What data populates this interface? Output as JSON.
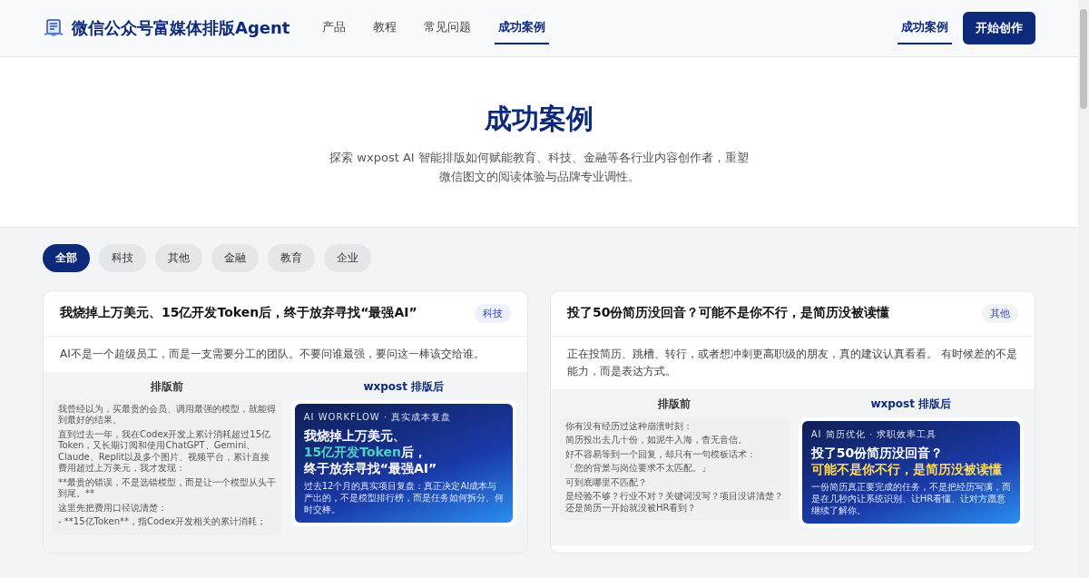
{
  "brand": {
    "name": "微信公众号富媒体排版Agent"
  },
  "nav": [
    {
      "label": "产品",
      "selected": false
    },
    {
      "label": "教程",
      "selected": false
    },
    {
      "label": "常见问题",
      "selected": false
    },
    {
      "label": "成功案例",
      "selected": true
    }
  ],
  "header_actions": {
    "link": {
      "label": "成功案例",
      "selected": true
    },
    "button": "开始创作"
  },
  "hero": {
    "title": "成功案例",
    "subtitle": "探索 wxpost AI 智能排版如何赋能教育、科技、金融等各行业内容创作者，重塑微信图文的阅读体验与品牌专业调性。"
  },
  "filters": [
    {
      "label": "全部",
      "selected": true
    },
    {
      "label": "科技",
      "selected": false
    },
    {
      "label": "其他",
      "selected": false
    },
    {
      "label": "金融",
      "selected": false
    },
    {
      "label": "教育",
      "selected": false
    },
    {
      "label": "企业",
      "selected": false
    }
  ],
  "cases": [
    {
      "title": "我烧掉上万美元、15亿开发Token后，终于放弃寻找“最强AI”",
      "tag": {
        "label": "科技",
        "color": "#eef0fe"
      },
      "description": "AI不是一个超级员工，而是一支需要分工的团队。不要问谁最强，要问这一棒该交给谁。",
      "before_label": "排版前",
      "after_label": "wxpost 排版后",
      "before": [
        "我曾经以为，买最贵的会员、调用最强的模型，就能得到最好的结果。",
        "直到过去一年，我在Codex开发上累计消耗超过15亿Token，又长期订阅和使用ChatGPT、Gemini、Claude、Replit以及多个图片、视频平台，累计直接费用超过上万美元，我才发现：",
        "**最贵的错误，不是选错模型，而是让一个模型从头干到尾。**",
        "这里先把费用口径说清楚：",
        "- **15亿Token**，指Codex开发相关的累计消耗；"
      ],
      "after": {
        "eyebrow": "AI WORKFLOW · 真实成本复盘",
        "title_lines": [
          [
            {
              "text": "我烧掉上万美元、",
              "color": "#ffffff"
            }
          ],
          [
            {
              "text": "15亿开发Token",
              "color": "#4fd1c5"
            },
            {
              "text": "后，",
              "color": "#ffffff"
            }
          ],
          [
            {
              "text": "终于放弃寻找“最强AI”",
              "color": "#ffffff"
            }
          ]
        ],
        "summary": "过去12个月的真实项目复盘：真正决定AI成本与产出的，不是模型排行榜，而是任务如何拆分、何时交棒。"
      }
    },
    {
      "title": "投了50份简历没回音？可能不是你不行，是简历没被读懂",
      "tag": {
        "label": "其他",
        "color": "#f1f2f4"
      },
      "description": "正在投简历、跳槽、转行，或者想冲刺更高职级的朋友，真的建议认真看看。 有时候差的不是能力，而是表达方式。",
      "before_label": "排版前",
      "after_label": "wxpost 排版后",
      "before": [
        "你有没有经历过这种崩溃时刻：",
        "简历投出去几十份，如泥牛入海，杳无音信。",
        "好不容易等到一个回复，却只有一句模板话术：",
        "「您的背景与岗位要求不太匹配。」",
        "可到底哪里不匹配？",
        "是经验不够？行业不对？关键词没写？项目没讲清楚？还是简历一开始就没被HR看到？"
      ],
      "after": {
        "eyebrow": "AI 简历优化 · 求职效率工具",
        "title_lines": [
          [
            {
              "text": "投了50份简历没回音？",
              "color": "#ffffff"
            }
          ],
          [
            {
              "text": "可能不是你不行，是简历没被读懂",
              "color": "#ffd95a"
            }
          ]
        ],
        "summary": "一份简历真正要完成的任务，不是把经历写满，而是在几秒内让系统识别、让HR看懂、让对方愿意继续了解你。"
      }
    }
  ]
}
